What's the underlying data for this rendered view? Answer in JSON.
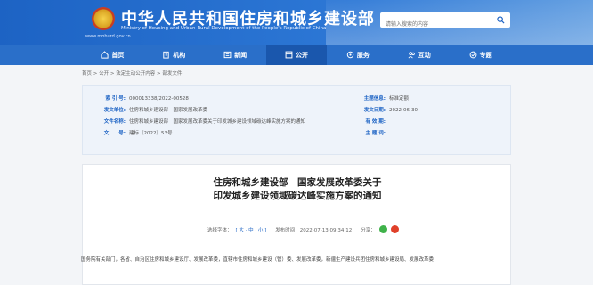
{
  "header": {
    "title": "中华人民共和国住房和城乡建设部",
    "subtitle": "Ministry of Housing and Urban-Rural Development of the People's Republic of China",
    "url": "www.mohurd.gov.cn",
    "search_placeholder": "请输入搜索的内容"
  },
  "nav": {
    "items": [
      {
        "label": "首页",
        "icon": "home-icon"
      },
      {
        "label": "机构",
        "icon": "building-icon"
      },
      {
        "label": "新闻",
        "icon": "news-icon"
      },
      {
        "label": "公开",
        "icon": "public-icon"
      },
      {
        "label": "服务",
        "icon": "service-icon"
      },
      {
        "label": "互动",
        "icon": "interact-icon"
      },
      {
        "label": "专题",
        "icon": "topic-icon"
      }
    ],
    "active_index": 3
  },
  "breadcrumb": "首页 > 公开 > 法定主动公开内容 > 部发文件",
  "meta": {
    "index_no_label": "索 引 号:",
    "index_no": "000013338/2022-00528",
    "category_label": "主题信息:",
    "category": "标准定额",
    "issuer_label": "发文单位:",
    "issuer": "住房和城乡建设部　国家发展改革委",
    "date_label": "发文日期:",
    "date": "2022-06-30",
    "name_label": "文件名称:",
    "name": "住房和城乡建设部　国家发展改革委关于印发城乡建设领域碳达峰实施方案的通知",
    "validity_label": "有 效 期:",
    "validity": "",
    "docno_label": "文　　号:",
    "docno": "建标〔2022〕53号",
    "topic_label": "主 题 词:",
    "topic": ""
  },
  "article": {
    "title_line1": "住房和城乡建设部　国家发展改革委关于",
    "title_line2": "印发城乡建设领域碳达峰实施方案的通知",
    "font_size_label": "选择字体：",
    "font_sizes": "[ 大 · 中 · 小 ]",
    "publish_time": "发布时间：2022-07-13 09:34:12",
    "share_label": "分享：",
    "body": "国务院有关部门，各省、自治区住房和城乡建设厅、发展改革委，直辖市住房和城乡建设（管）委、发展改革委，新疆生产建设兵团住房和城乡建设局、发展改革委："
  }
}
